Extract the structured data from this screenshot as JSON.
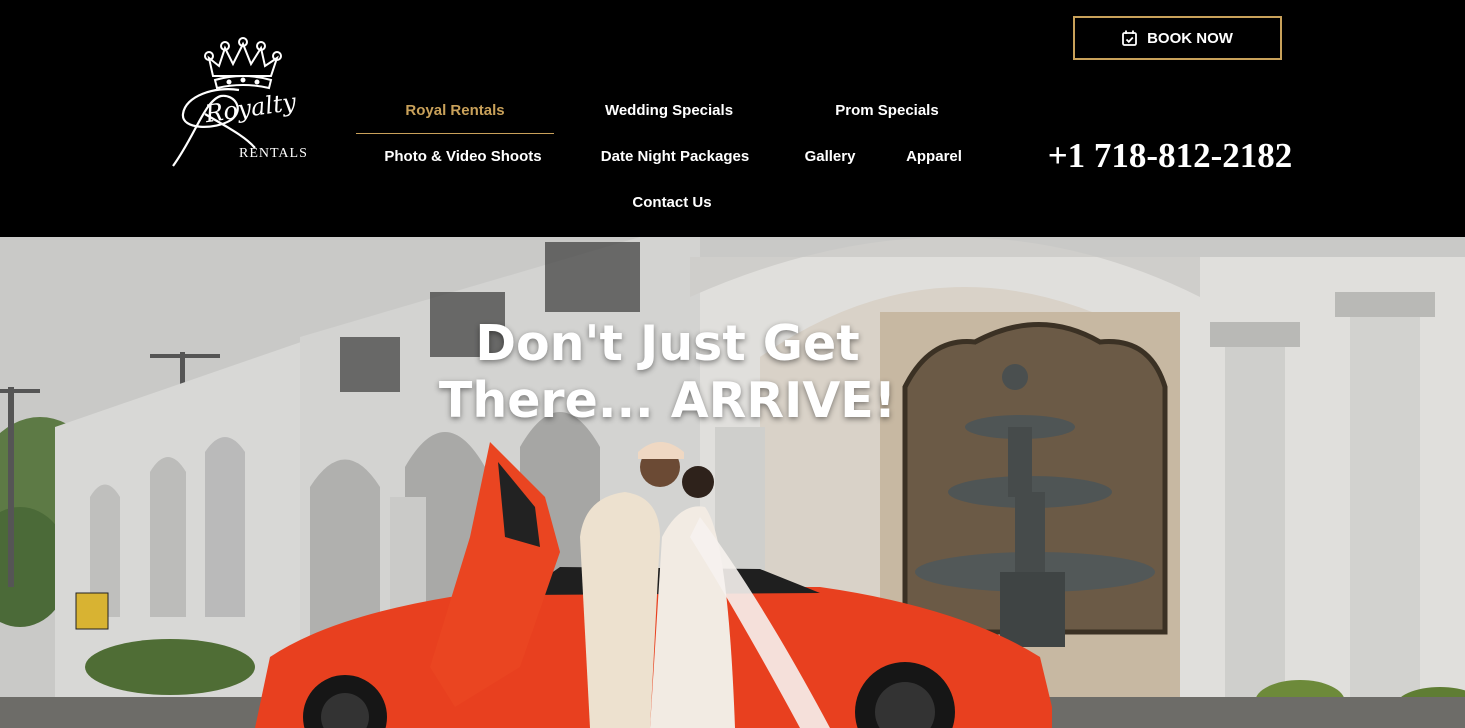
{
  "logo": {
    "script_text": "Royalty",
    "sub_text": "RENTALS"
  },
  "header": {
    "book_now_label": "BOOK NOW",
    "phone": "+1 718-812-2182"
  },
  "nav": {
    "royal_rentals": "Royal Rentals",
    "wedding_specials": "Wedding Specials",
    "prom_specials": "Prom Specials",
    "photo_video": "Photo & Video Shoots",
    "date_night": "Date Night Packages",
    "gallery": "Gallery",
    "apparel": "Apparel",
    "contact": "Contact Us",
    "active": "Royal Rentals"
  },
  "hero": {
    "title_line1": "Don't Just Get",
    "title_line2": "There... ARRIVE!"
  },
  "colors": {
    "accent_gold": "#c9a15a",
    "header_bg": "#000000",
    "car_orange": "#e8401f"
  },
  "icons": {
    "book_button": "calendar-check-icon",
    "logo": "crown-icon"
  }
}
